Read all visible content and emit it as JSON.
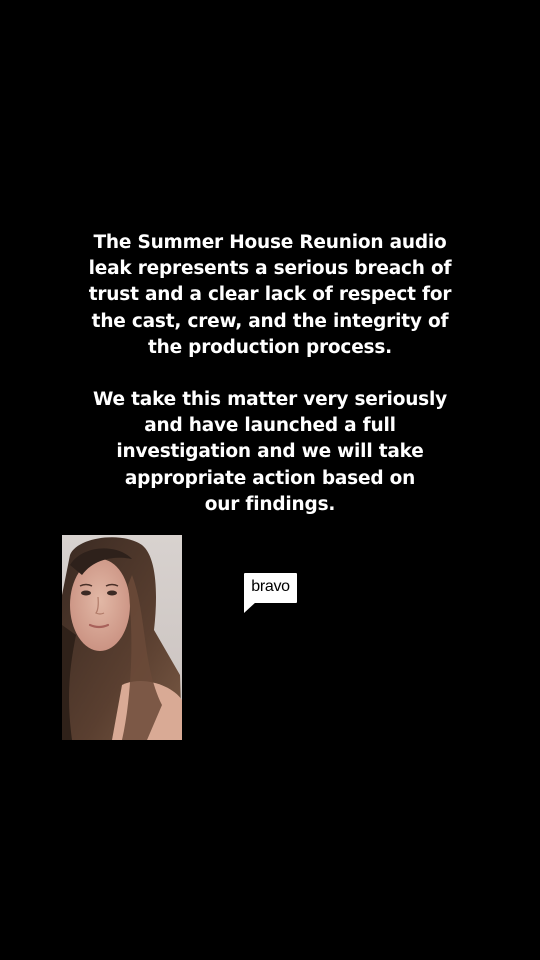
{
  "statement": {
    "paragraph1_lines": [
      "The Summer House Reunion audio",
      "leak represents a serious breach of",
      "trust and a clear lack of respect for",
      "the cast, crew, and the integrity of",
      "the production process."
    ],
    "paragraph2_lines": [
      "We take this matter very seriously",
      "and have launched a full",
      "investigation and we will take",
      "appropriate action based on",
      "our findings."
    ]
  },
  "logo": {
    "text": "bravo"
  },
  "colors": {
    "background": "#000000",
    "text": "#ffffff",
    "logo_box": "#ffffff",
    "logo_text": "#000000"
  }
}
